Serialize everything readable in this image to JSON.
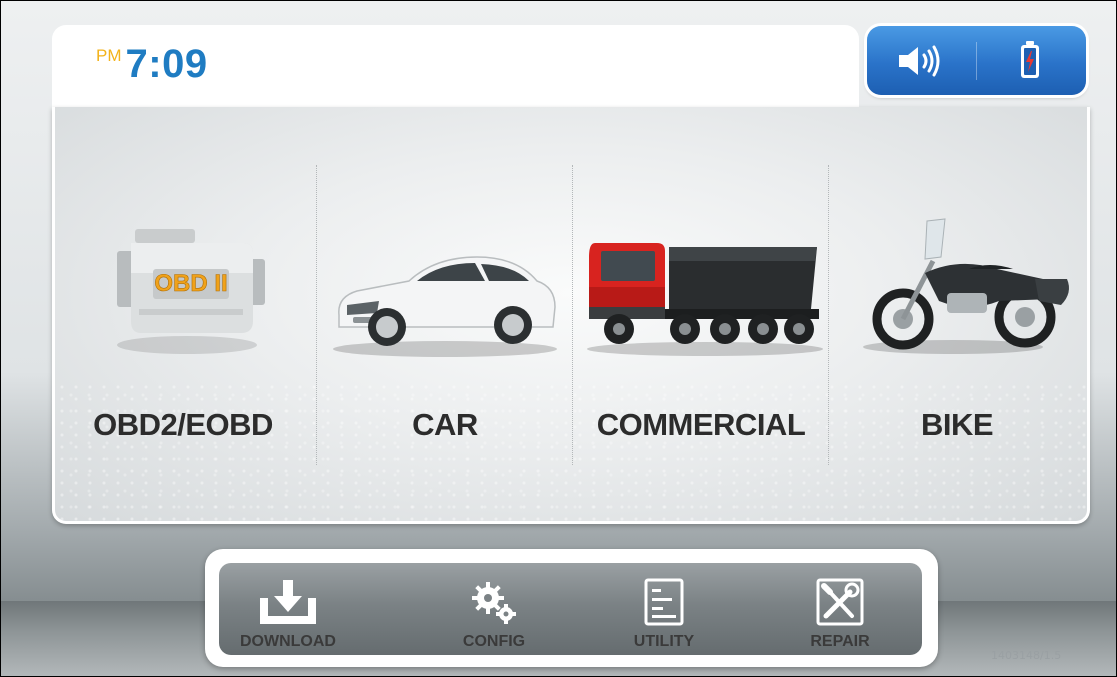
{
  "clock": {
    "ampm": "PM",
    "time": "7:09"
  },
  "status": {
    "volume_icon": "speaker-volume-icon",
    "battery_icon": "battery-charging-icon"
  },
  "categories": [
    {
      "label": "OBD2/EOBD",
      "icon": "obd-ii-engine-icon",
      "badge": "OBD II"
    },
    {
      "label": "CAR",
      "icon": "sedan-car-icon"
    },
    {
      "label": "COMMERCIAL",
      "icon": "dump-truck-icon"
    },
    {
      "label": "BIKE",
      "icon": "motorcycle-icon"
    }
  ],
  "dock": [
    {
      "label": "DOWNLOAD",
      "icon": "download-icon"
    },
    {
      "label": "CONFIG",
      "icon": "gears-icon"
    },
    {
      "label": "UTILITY",
      "icon": "list-document-icon"
    },
    {
      "label": "REPAIR",
      "icon": "wrench-screwdriver-icon"
    }
  ],
  "footer": {
    "serial": "1403148/1.5"
  },
  "colors": {
    "time": "#1f7cc2",
    "ampm": "#f3b31b",
    "status_box": "#2a73c9",
    "truck_cab": "#d8231f"
  }
}
